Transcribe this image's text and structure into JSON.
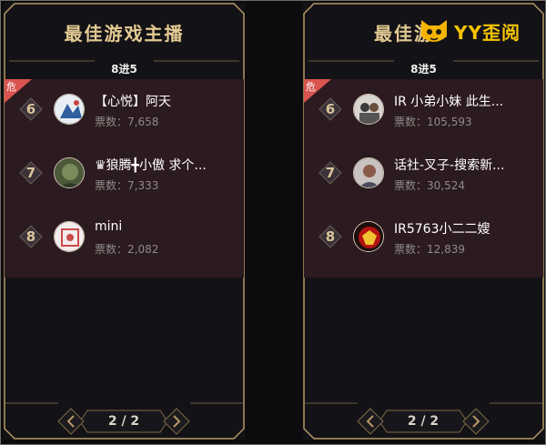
{
  "panels": [
    {
      "title": "最佳游戏主播",
      "subtitle": "8进5",
      "danger_label": "危",
      "rows": [
        {
          "rank": "6",
          "name": "【心悦】阿天",
          "votes": "票数：7,658"
        },
        {
          "rank": "7",
          "name": "♛狼腾╋小傲 求个...",
          "votes": "票数：7,333"
        },
        {
          "rank": "8",
          "name": "mini",
          "votes": "票数：2,082"
        }
      ],
      "pager": "2 / 2"
    },
    {
      "title": "最佳游",
      "subtitle": "8进5",
      "danger_label": "危",
      "rows": [
        {
          "rank": "6",
          "name": "IR 小弟小妹 此生...",
          "votes": "票数：105,593"
        },
        {
          "rank": "7",
          "name": "话社-叉子-搜索新...",
          "votes": "票数：30,524"
        },
        {
          "rank": "8",
          "name": "IR5763小二二嫂",
          "votes": "票数：12,839"
        }
      ],
      "pager": "2 / 2"
    }
  ],
  "watermark": {
    "text": "YY歪阅"
  },
  "colors": {
    "gold": "#e3ca93",
    "list_bg": "#2b1a1f",
    "danger": "#d9534f"
  }
}
